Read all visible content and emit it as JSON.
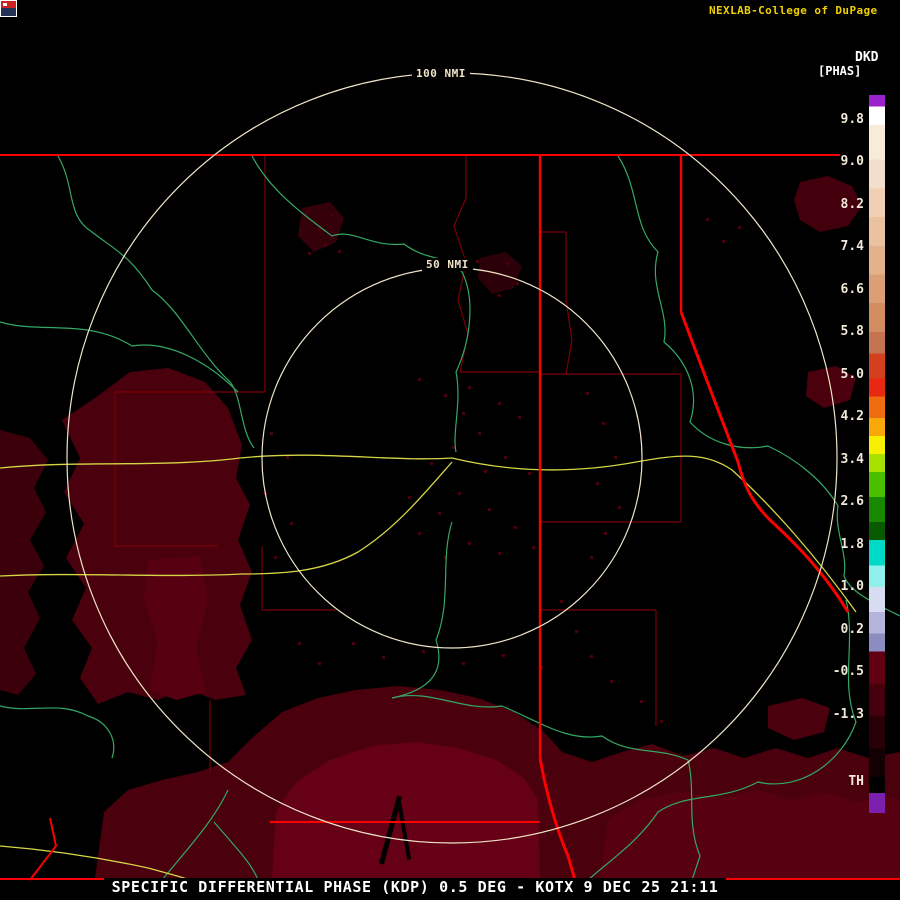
{
  "header": {
    "site": "NEXLAB-College of DuPage",
    "product_code": "DKD",
    "product_unit": "[PHAS]"
  },
  "scale": {
    "ticks": [
      "9.8",
      "9.0",
      "8.2",
      "7.4",
      "6.6",
      "5.8",
      "5.0",
      "4.2",
      "3.4",
      "2.6",
      "1.8",
      "1.0",
      "0.2",
      "-0.5",
      "-1.3"
    ],
    "threshold_label": "TH",
    "segments": [
      {
        "color": "#9a22cc",
        "from": 0,
        "to": 1.6
      },
      {
        "color": "#ffffff",
        "from": 1.6,
        "to": 4.2
      },
      {
        "color": "#f7ecd9",
        "from": 4.2,
        "to": 9
      },
      {
        "color": "#f3decb",
        "from": 9,
        "to": 13
      },
      {
        "color": "#efd0b4",
        "from": 13,
        "to": 17
      },
      {
        "color": "#eac29f",
        "from": 17,
        "to": 21
      },
      {
        "color": "#e4b18a",
        "from": 21,
        "to": 25
      },
      {
        "color": "#dc9f75",
        "from": 25,
        "to": 29
      },
      {
        "color": "#d28c62",
        "from": 29,
        "to": 33
      },
      {
        "color": "#c67450",
        "from": 33,
        "to": 36
      },
      {
        "color": "#d4401e",
        "from": 36,
        "to": 39.5
      },
      {
        "color": "#e82810",
        "from": 39.5,
        "to": 42
      },
      {
        "color": "#f06c10",
        "from": 42,
        "to": 45
      },
      {
        "color": "#f8a808",
        "from": 45,
        "to": 47.5
      },
      {
        "color": "#f8f000",
        "from": 47.5,
        "to": 50
      },
      {
        "color": "#a8e000",
        "from": 50,
        "to": 52.5
      },
      {
        "color": "#48c000",
        "from": 52.5,
        "to": 56
      },
      {
        "color": "#188800",
        "from": 56,
        "to": 59.5
      },
      {
        "color": "#0a5a00",
        "from": 59.5,
        "to": 62
      },
      {
        "color": "#00d8c8",
        "from": 62,
        "to": 65.5
      },
      {
        "color": "#90f0ec",
        "from": 65.5,
        "to": 68.5
      },
      {
        "color": "#d8dcf2",
        "from": 68.5,
        "to": 72
      },
      {
        "color": "#b4b4dc",
        "from": 72,
        "to": 75
      },
      {
        "color": "#8c8cc0",
        "from": 75,
        "to": 77.5
      },
      {
        "color": "#600012",
        "from": 77.5,
        "to": 82
      },
      {
        "color": "#46000d",
        "from": 82,
        "to": 86.5
      },
      {
        "color": "#2a0008",
        "from": 86.5,
        "to": 91
      },
      {
        "color": "#120004",
        "from": 91,
        "to": 95
      },
      {
        "color": "#000000",
        "from": 95,
        "to": 97.2
      },
      {
        "color": "#7a1fae",
        "from": 97.2,
        "to": 100
      }
    ]
  },
  "map": {
    "outer_ring_label": "100 NMI",
    "inner_ring_label": "50 NMI"
  },
  "caption": "SPECIFIC DIFFERENTIAL PHASE (KDP) 0.5 DEG - KOTX 9 DEC 25 21:11",
  "colors": {
    "bg": "#000000",
    "title": "#f0d000",
    "text": "#ffffff",
    "tick": "#f0e8d8",
    "ring": "#efe4c8",
    "state": "#fb0000",
    "county": "#7a0008",
    "river": "#35a865",
    "road": "#d6d645",
    "echo": "#4a000d",
    "echo_mid": "#570011",
    "echo_bright": "#650016"
  }
}
